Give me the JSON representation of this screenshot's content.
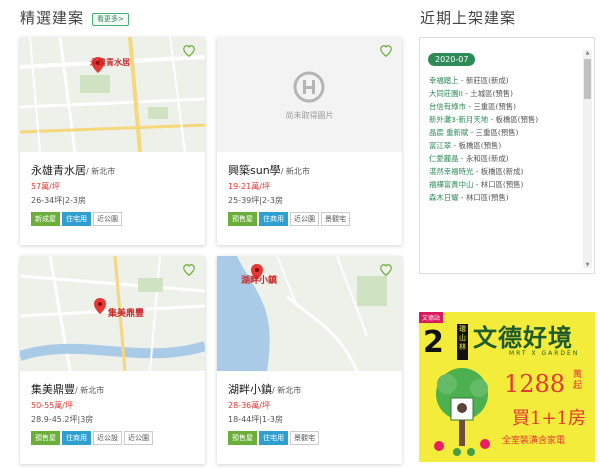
{
  "featured": {
    "title": "精選建案",
    "more_label": "看更多>"
  },
  "cards": [
    {
      "name": "永雄青水居",
      "region": "/ 新北市",
      "price": "57萬/坪",
      "size": "26-34坪|2-3房",
      "map_label": "永雄青水居",
      "tags": [
        {
          "label": "新成屋",
          "style": "green"
        },
        {
          "label": "住宅用",
          "style": "blue"
        },
        {
          "label": "近公園",
          "style": "plain"
        }
      ]
    },
    {
      "name": "興築sun學",
      "region": "/ 新北市",
      "price": "19-21萬/坪",
      "size": "25-39坪|2-3房",
      "placeholder_text": "尚未取得圖片",
      "tags": [
        {
          "label": "預售屋",
          "style": "green"
        },
        {
          "label": "住商用",
          "style": "blue"
        },
        {
          "label": "近公園",
          "style": "plain"
        },
        {
          "label": "景觀宅",
          "style": "plain"
        }
      ]
    },
    {
      "name": "集美鼎豐",
      "region": "/ 新北市",
      "price": "50-55萬/坪",
      "size": "28.9-45.2坪|3房",
      "map_label": "集美鼎豐",
      "tags": [
        {
          "label": "預售屋",
          "style": "green"
        },
        {
          "label": "住商用",
          "style": "blue"
        },
        {
          "label": "近公設",
          "style": "plain"
        },
        {
          "label": "近公園",
          "style": "plain"
        }
      ]
    },
    {
      "name": "湖畔小鎮",
      "region": "/ 新北市",
      "price": "28-36萬/坪",
      "size": "18-44坪|1-3房",
      "map_label": "湖畔小鎮",
      "tags": [
        {
          "label": "預售屋",
          "style": "green"
        },
        {
          "label": "住宅用",
          "style": "blue"
        },
        {
          "label": "景觀宅",
          "style": "plain"
        }
      ]
    }
  ],
  "recent": {
    "title": "近期上架建案",
    "month": "2020-07",
    "items": [
      {
        "link": "幸福踏上",
        "rest": " - 新莊區(新成)"
      },
      {
        "link": "大同莊園II",
        "rest": " - 土城區(預售)"
      },
      {
        "link": "台信有綠市",
        "rest": " - 三重區(預售)"
      },
      {
        "link": "新外灘3-新月天地",
        "rest": " - 板橋區(預售)"
      },
      {
        "link": "晶宸 重新賦",
        "rest": " - 三重區(預售)"
      },
      {
        "link": "富江翠",
        "rest": " - 板橋區(預售)"
      },
      {
        "link": "仁愛麗晶",
        "rest": " - 永和區(新成)"
      },
      {
        "link": "湛然幸福時光",
        "rest": " - 板橋區(新成)"
      },
      {
        "link": "福樺富貴中山",
        "rest": " - 林口區(預售)"
      },
      {
        "link": "森木日耀",
        "rest": " - 林口區(預售)"
      }
    ]
  },
  "ad": {
    "badge": "文德站",
    "rank": "2",
    "location": "環山林",
    "brand": "文德好境",
    "sub": "MRT X GARDEN",
    "price": "1288",
    "price_unit": "萬起",
    "rooms": "買1+1房",
    "slogan": "全室裝潢含家電"
  },
  "colors": {
    "accent": "#2e8b57",
    "price": "#e53935",
    "tag_green": "#6bae3a",
    "tag_blue": "#2f9fd0"
  }
}
